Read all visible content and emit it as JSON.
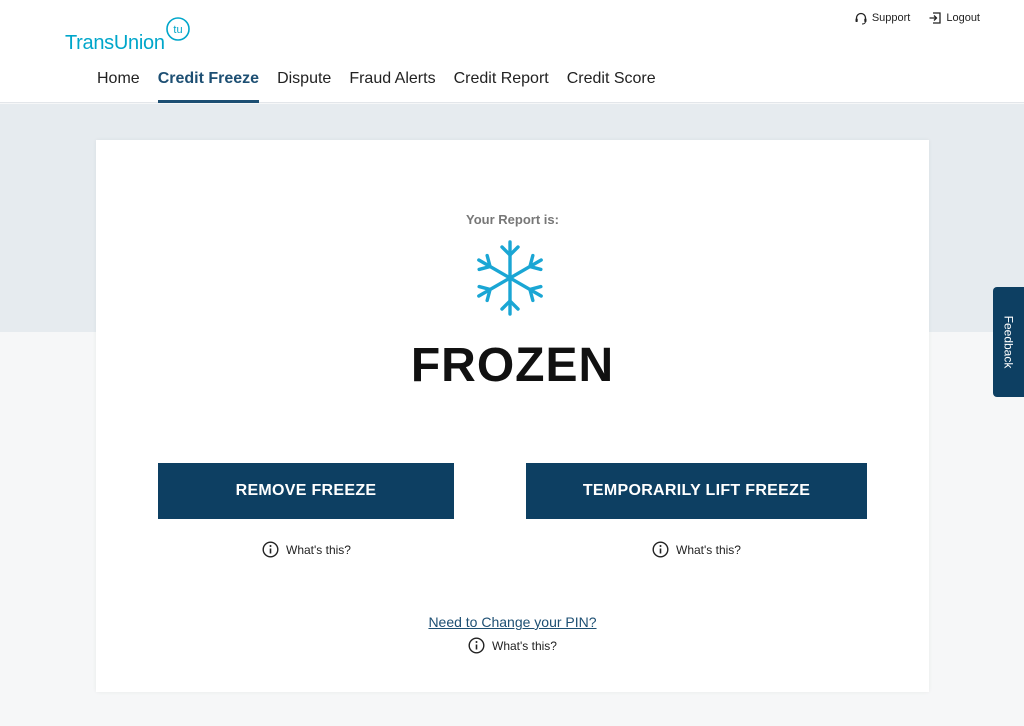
{
  "brand": {
    "name": "TransUnion",
    "mark": "tu",
    "color": "#00a6ca"
  },
  "top_links": {
    "support": "Support",
    "logout": "Logout"
  },
  "nav": {
    "items": [
      {
        "label": "Home",
        "active": false
      },
      {
        "label": "Credit Freeze",
        "active": true
      },
      {
        "label": "Dispute",
        "active": false
      },
      {
        "label": "Fraud Alerts",
        "active": false
      },
      {
        "label": "Credit Report",
        "active": false
      },
      {
        "label": "Credit Score",
        "active": false
      }
    ]
  },
  "report": {
    "label": "Your Report is:",
    "status": "FROZEN",
    "icon": "snowflake-icon"
  },
  "actions": {
    "remove_freeze": "REMOVE FREEZE",
    "lift_freeze": "TEMPORARILY LIFT FREEZE",
    "whats_this": "What's this?",
    "change_pin": "Need to Change your PIN?"
  },
  "feedback": {
    "label": "Feedback"
  },
  "colors": {
    "primary": "#0d3f62",
    "accent": "#00a6ca",
    "link": "#1d4f73"
  }
}
